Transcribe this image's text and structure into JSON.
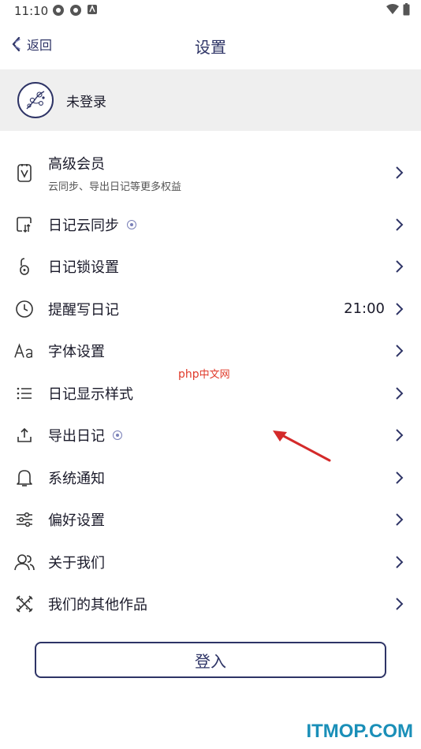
{
  "status_bar": {
    "time": "11:10"
  },
  "nav": {
    "back_label": "返回",
    "title": "设置"
  },
  "account": {
    "name": "未登录"
  },
  "menu": [
    {
      "label": "高级会员",
      "sub": "云同步、导出日记等更多权益",
      "icon": "membership-icon"
    },
    {
      "label": "日记云同步",
      "badge": true,
      "icon": "cloud-sync-icon"
    },
    {
      "label": "日记锁设置",
      "icon": "lock-icon"
    },
    {
      "label": "提醒写日记",
      "value": "21:00",
      "icon": "clock-icon"
    },
    {
      "label": "字体设置",
      "icon": "font-icon"
    },
    {
      "label": "日记显示样式",
      "icon": "list-icon"
    },
    {
      "label": "导出日记",
      "badge": true,
      "icon": "export-icon"
    },
    {
      "label": "系统通知",
      "icon": "bell-icon"
    },
    {
      "label": "偏好设置",
      "icon": "sliders-icon"
    },
    {
      "label": "关于我们",
      "icon": "users-icon"
    },
    {
      "label": "我们的其他作品",
      "icon": "tools-icon"
    }
  ],
  "login_button": "登入",
  "watermarks": {
    "php": "php",
    "php_cn": "中文网",
    "itmop": "ITMOP.COM"
  },
  "colors": {
    "accent": "#2e3466",
    "header_bg": "#efefef",
    "annotation_arrow": "#d42a2a"
  }
}
